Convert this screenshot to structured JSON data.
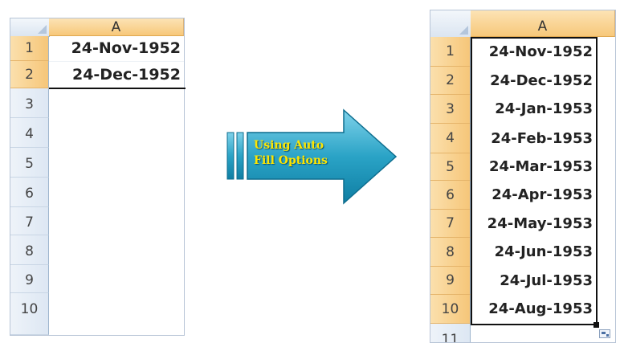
{
  "left_sheet": {
    "column_header": "A",
    "row_numbers": [
      "1",
      "2",
      "3",
      "4",
      "5",
      "6",
      "7",
      "8",
      "9",
      "10"
    ],
    "cells": [
      "24-Nov-1952",
      "24-Dec-1952"
    ]
  },
  "arrow": {
    "label_line1": "Using Auto",
    "label_line2": "Fill Options"
  },
  "right_sheet": {
    "column_header": "A",
    "row_numbers": [
      "1",
      "2",
      "3",
      "4",
      "5",
      "6",
      "7",
      "8",
      "9",
      "10",
      "11"
    ],
    "cells": [
      "24-Nov-1952",
      "24-Dec-1952",
      "24-Jan-1953",
      "24-Feb-1953",
      "24-Mar-1953",
      "24-Apr-1953",
      "24-May-1953",
      "24-Jun-1953",
      "24-Jul-1953",
      "24-Aug-1953"
    ]
  },
  "colors": {
    "header_selected": "#f7c87a",
    "arrow_body": "#2aa3c6",
    "arrow_text": "#ffe600"
  },
  "icons": [
    "select-all-corner-icon",
    "fill-handle-icon",
    "auto-fill-options-icon",
    "arrow-icon"
  ]
}
